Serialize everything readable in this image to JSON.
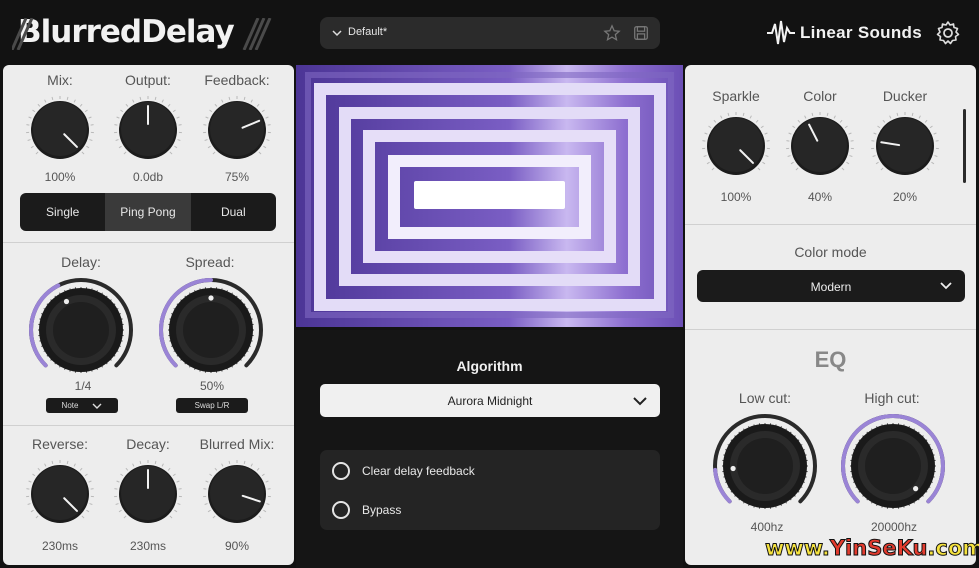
{
  "header": {
    "app_name": "BlurredDelay",
    "preset": "Default*",
    "brand": "Linear Sounds"
  },
  "left": {
    "top_knobs": [
      {
        "label": "Mix:",
        "value": "100%",
        "level": 1.0
      },
      {
        "label": "Output:",
        "value": "0.0db",
        "level": 0.5
      },
      {
        "label": "Feedback:",
        "value": "75%",
        "level": 0.75
      }
    ],
    "mode_buttons": [
      "Single",
      "Ping Pong",
      "Dual"
    ],
    "active_mode": "Ping Pong",
    "mid_knobs": [
      {
        "label": "Delay:",
        "value": "1/4",
        "dropdown": "Note",
        "level": 0.4
      },
      {
        "label": "Spread:",
        "value": "50%",
        "dropdown": "Swap L/R",
        "level": 0.5
      }
    ],
    "bottom_knobs": [
      {
        "label": "Reverse:",
        "value": "230ms",
        "level": 1.0
      },
      {
        "label": "Decay:",
        "value": "230ms",
        "level": 0.5
      },
      {
        "label": "Blurred Mix:",
        "value": "90%",
        "level": 0.9
      }
    ]
  },
  "center": {
    "algorithm_title": "Algorithm",
    "algorithm_value": "Aurora Midnight",
    "options": [
      {
        "label": "Clear delay feedback",
        "checked": false
      },
      {
        "label": "Bypass",
        "checked": false
      }
    ]
  },
  "right": {
    "knobs": [
      {
        "label": "Sparkle",
        "value": "100%",
        "level": 1.0
      },
      {
        "label": "Color",
        "value": "40%",
        "level": 0.4
      },
      {
        "label": "Ducker",
        "value": "20%",
        "level": 0.2
      }
    ],
    "color_mode_title": "Color mode",
    "color_mode_value": "Modern",
    "eq_title": "EQ",
    "eq_knobs": [
      {
        "label": "Low cut:",
        "value": "400hz",
        "level": 0.15
      },
      {
        "label": "High cut:",
        "value": "20000hz",
        "level": 1.0
      }
    ]
  },
  "colors": {
    "accent_purple": "#9a84d6",
    "viz_purple": "#6a4fb0",
    "knob_dark": "#1e1e1e",
    "panel_light": "#ededed"
  },
  "watermark": {
    "part1": "www.",
    "part2": "YinSeKu",
    "part3": ".com"
  }
}
